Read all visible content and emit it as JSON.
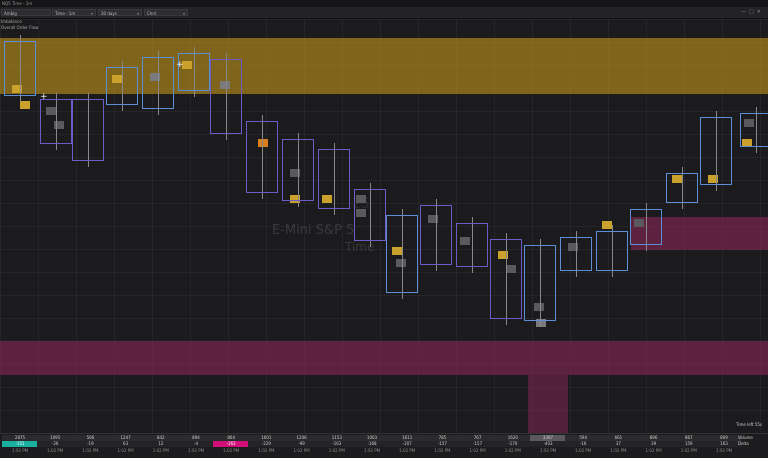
{
  "window": {
    "title": "NQ5 Time - 1m"
  },
  "toolbar": {
    "symbol": "Ambig",
    "chart_type": "Time - 1m",
    "range": "30 days",
    "setting": "Chnl"
  },
  "indicator": {
    "name": "Imbalance",
    "subtitle": "Overall Order Flow"
  },
  "watermark": {
    "line1": "E-Mini S&P 5",
    "line2": "Time",
    "big": "25"
  },
  "status": {
    "time_left": "Time left 55s"
  },
  "colors": {
    "supply": "#d2a019",
    "demand": "#962860",
    "bar_down": "#6b5cc7",
    "bar_up": "#5c8fd6",
    "volume_hi": "#1ab0a0",
    "delta_neg": "#d01078"
  },
  "footer": {
    "volume_label": "Volume",
    "delta_label": "Delta",
    "columns": [
      {
        "volume": "2875",
        "delta": "-151",
        "time": "1:02 PM"
      },
      {
        "volume": "1095",
        "delta": "-26",
        "time": "1:02 PM"
      },
      {
        "volume": "566",
        "delta": "-19",
        "time": "1:02 PM"
      },
      {
        "volume": "1247",
        "delta": "63",
        "time": "1:02 PM"
      },
      {
        "volume": "842",
        "delta": "12",
        "time": "1:02 PM"
      },
      {
        "volume": "894",
        "delta": "-4",
        "time": "1:02 PM"
      },
      {
        "volume": "864",
        "delta": "-262",
        "time": "1:02 PM"
      },
      {
        "volume": "1601",
        "delta": "-229",
        "time": "1:02 PM"
      },
      {
        "volume": "1206",
        "delta": "-99",
        "time": "1:02 PM"
      },
      {
        "volume": "1153",
        "delta": "-163",
        "time": "1:02 PM"
      },
      {
        "volume": "1003",
        "delta": "-168",
        "time": "1:02 PM"
      },
      {
        "volume": "1611",
        "delta": "-207",
        "time": "1:02 PM"
      },
      {
        "volume": "785",
        "delta": "-157",
        "time": "1:02 PM"
      },
      {
        "volume": "767",
        "delta": "-157",
        "time": "1:02 PM"
      },
      {
        "volume": "1620",
        "delta": "-170",
        "time": "1:02 PM"
      },
      {
        "volume": "3397",
        "delta": "-403",
        "time": "1:02 PM"
      },
      {
        "volume": "594",
        "delta": "-16",
        "time": "1:02 PM"
      },
      {
        "volume": "661",
        "delta": "37",
        "time": "1:02 PM"
      },
      {
        "volume": "896",
        "delta": "39",
        "time": "1:02 PM"
      },
      {
        "volume": "867",
        "delta": "159",
        "time": "1:02 PM"
      },
      {
        "volume": "809",
        "delta": "163",
        "time": "1:02 PM"
      }
    ]
  }
}
